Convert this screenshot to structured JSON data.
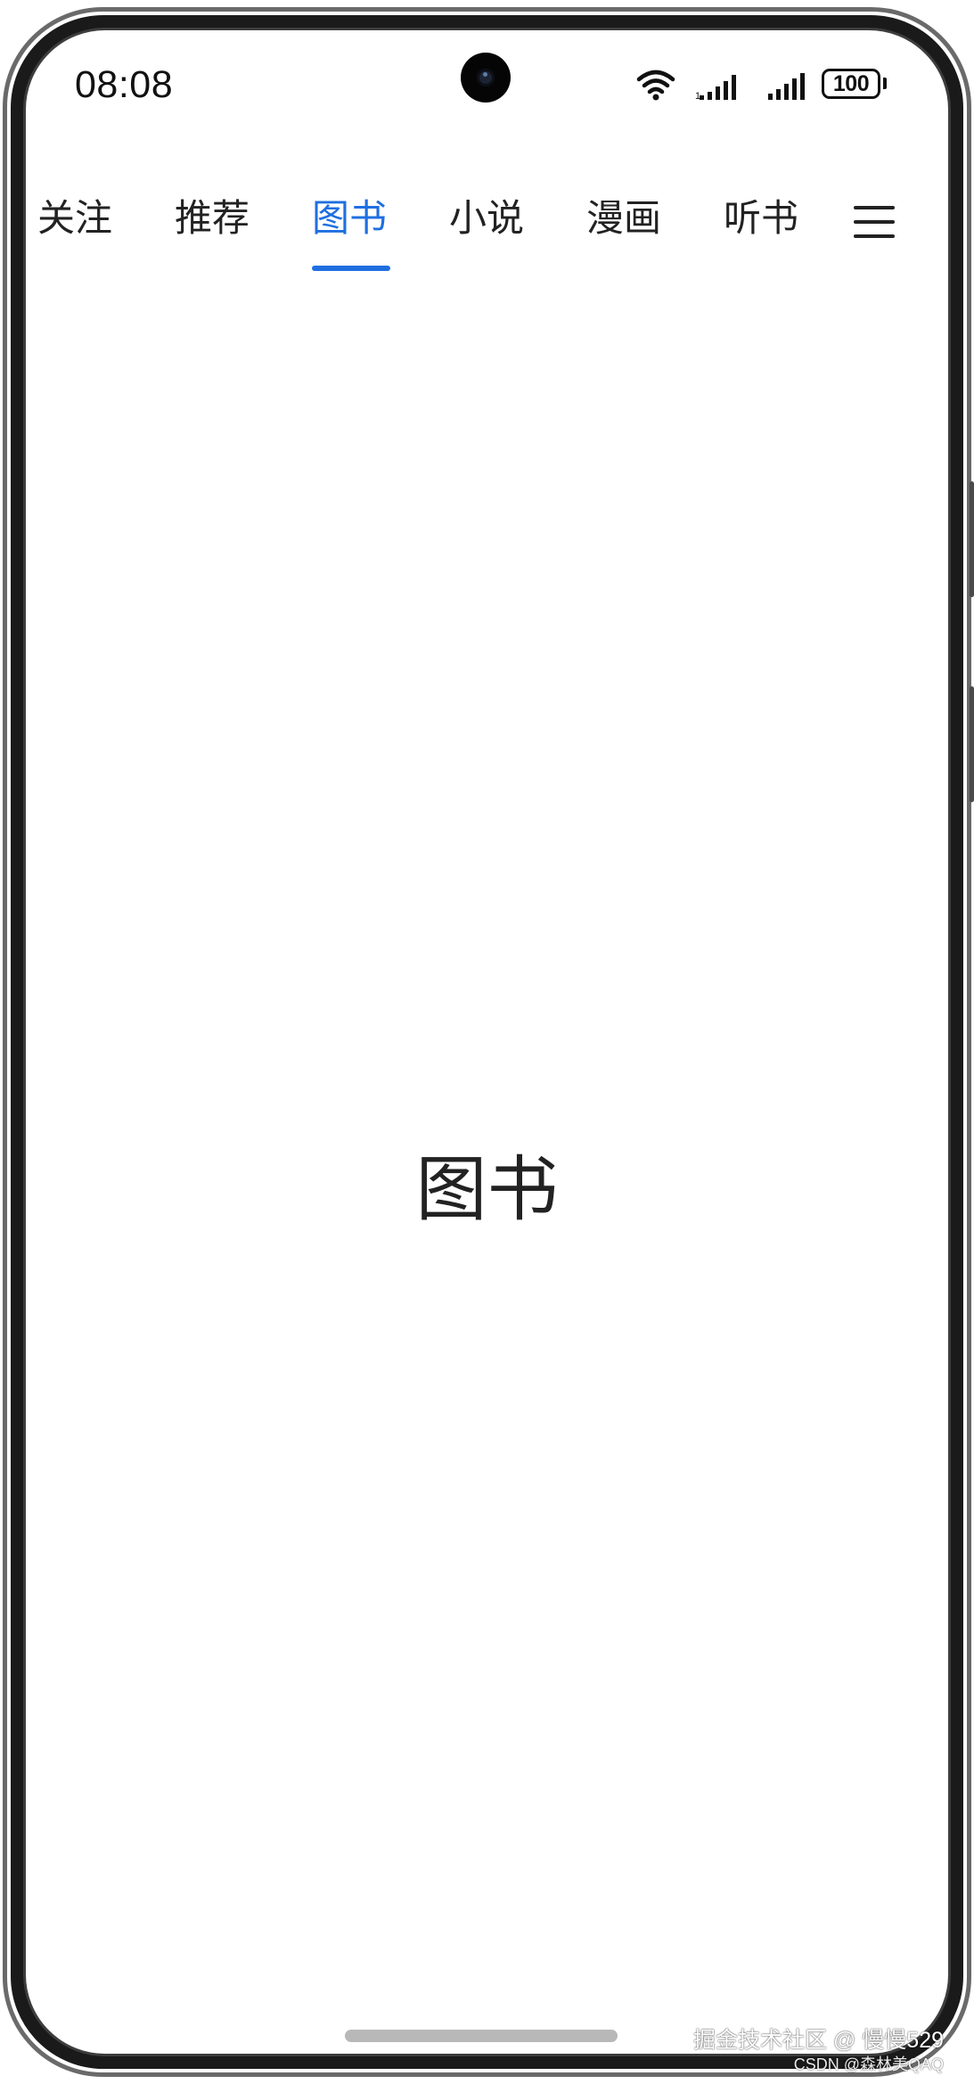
{
  "status_bar": {
    "time": "08:08",
    "battery_level": "100"
  },
  "tabs": [
    {
      "label": "关注",
      "active": false
    },
    {
      "label": "推荐",
      "active": false
    },
    {
      "label": "图书",
      "active": true
    },
    {
      "label": "小说",
      "active": false
    },
    {
      "label": "漫画",
      "active": false
    },
    {
      "label": "听书",
      "active": false
    }
  ],
  "content": {
    "title": "图书"
  },
  "watermark": {
    "line1": "掘金技术社区 @ 慢慢529",
    "line2": "CSDN @森林美QAQ"
  },
  "colors": {
    "accent": "#1f6fe0",
    "text": "#222222",
    "background": "#ffffff"
  },
  "icons": {
    "menu": "menu-icon",
    "wifi": "wifi-icon",
    "signal": "signal-icon",
    "battery": "battery-icon",
    "camera": "front-camera-icon"
  }
}
